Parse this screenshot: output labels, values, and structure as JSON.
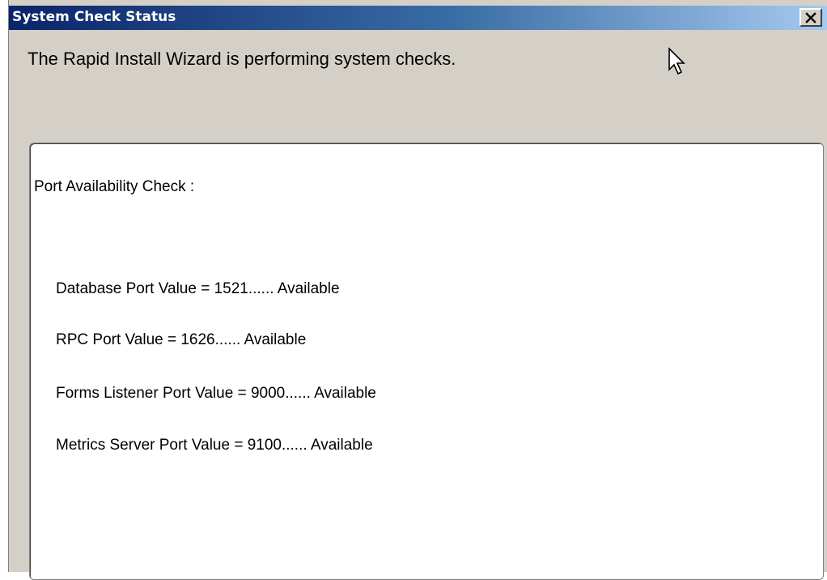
{
  "window": {
    "title": "System Check Status",
    "close_icon": "close-icon"
  },
  "message": "The Rapid Install Wizard is performing system checks.",
  "panel": {
    "heading": "Port Availability Check :",
    "items": [
      {
        "label": "Database Port Value = 1521......  Available"
      },
      {
        "label": "RPC Port Value = 1626......  Available"
      },
      {
        "label": "Forms Listener Port Value = 9000......  Available"
      },
      {
        "label": "Metrics Server Port Value = 9100......  Available"
      }
    ]
  },
  "colors": {
    "titlebar_start": "#0a246a",
    "titlebar_end": "#a6caf0",
    "window_bg": "#d4d0c8",
    "panel_bg": "#ffffff"
  }
}
